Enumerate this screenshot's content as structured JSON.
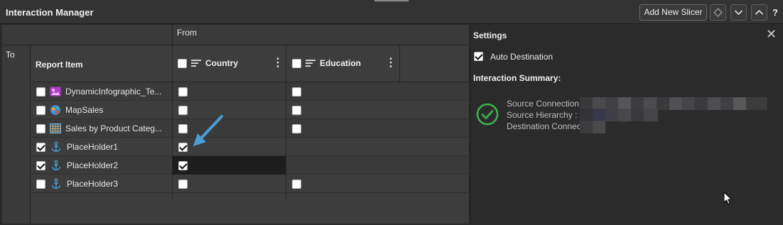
{
  "window": {
    "title": "Interaction Manager",
    "help": "?"
  },
  "toolbar": {
    "add_slicer_label": "Add New Slicer",
    "icons": [
      "diamond-icon",
      "chevron-down-icon",
      "chevron-up-icon"
    ]
  },
  "grid": {
    "from_label": "From",
    "to_label": "To",
    "report_item_header": "Report Item",
    "columns": [
      {
        "label": "Country",
        "header_checked": false
      },
      {
        "label": "Education",
        "header_checked": false
      }
    ],
    "rows": [
      {
        "label": "DynamicInfographic_Te...",
        "icon": "infographic-icon",
        "checked": false,
        "country": false,
        "education": false
      },
      {
        "label": "MapSales",
        "icon": "globe-icon",
        "checked": false,
        "country": false,
        "education": false
      },
      {
        "label": "Sales by Product Categ...",
        "icon": "grid-table-icon",
        "checked": false,
        "country": false,
        "education": false
      },
      {
        "label": "PlaceHolder1",
        "icon": "anchor-icon",
        "checked": true,
        "country": true,
        "education": null
      },
      {
        "label": "PlaceHolder2",
        "icon": "anchor-icon",
        "checked": true,
        "country": true,
        "education": null
      },
      {
        "label": "PlaceHolder3",
        "icon": "anchor-icon",
        "checked": false,
        "country": false,
        "education": false
      }
    ]
  },
  "settings": {
    "title": "Settings",
    "auto_destination_label": "Auto Destination",
    "auto_destination_checked": true,
    "summary_title": "Interaction Summary:",
    "summary_lines": [
      "Source Connection",
      "Source Hierarchy : [",
      "Destination Connec"
    ]
  },
  "colors": {
    "accent_blue": "#4a9fd8",
    "ok_green": "#3db34a",
    "infographic_purple": "#b040c8"
  }
}
